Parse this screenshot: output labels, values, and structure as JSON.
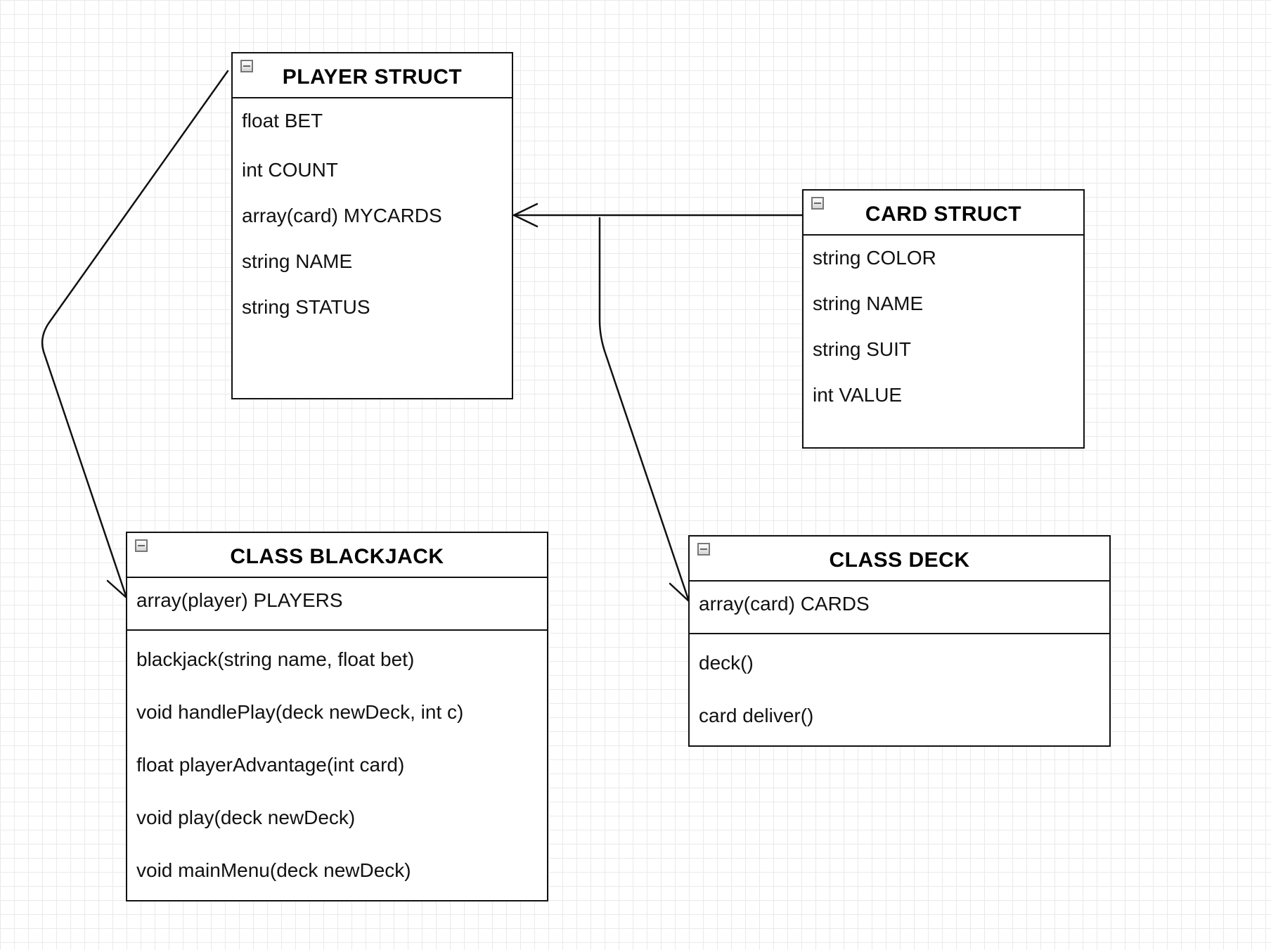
{
  "diagram": {
    "player_struct": {
      "title": "PLAYER STRUCT",
      "attributes": [
        "float BET",
        "int COUNT",
        "array(card) MYCARDS",
        "string NAME",
        "string STATUS"
      ]
    },
    "card_struct": {
      "title": "CARD STRUCT",
      "attributes": [
        "string COLOR",
        "string NAME",
        "string SUIT",
        "int VALUE"
      ]
    },
    "class_blackjack": {
      "title": "CLASS BLACKJACK",
      "attributes": [
        "array(player) PLAYERS"
      ],
      "methods": [
        "blackjack(string name, float bet)",
        "void handlePlay(deck newDeck, int c)",
        "float playerAdvantage(int card)",
        "void play(deck newDeck)",
        "void mainMenu(deck newDeck)"
      ]
    },
    "class_deck": {
      "title": "CLASS DECK",
      "attributes": [
        "array(card) CARDS"
      ],
      "methods": [
        "deck()",
        "card deliver()"
      ]
    }
  },
  "colors": {
    "line": "#111111",
    "grid": "#eaeaea",
    "background": "#ffffff"
  }
}
